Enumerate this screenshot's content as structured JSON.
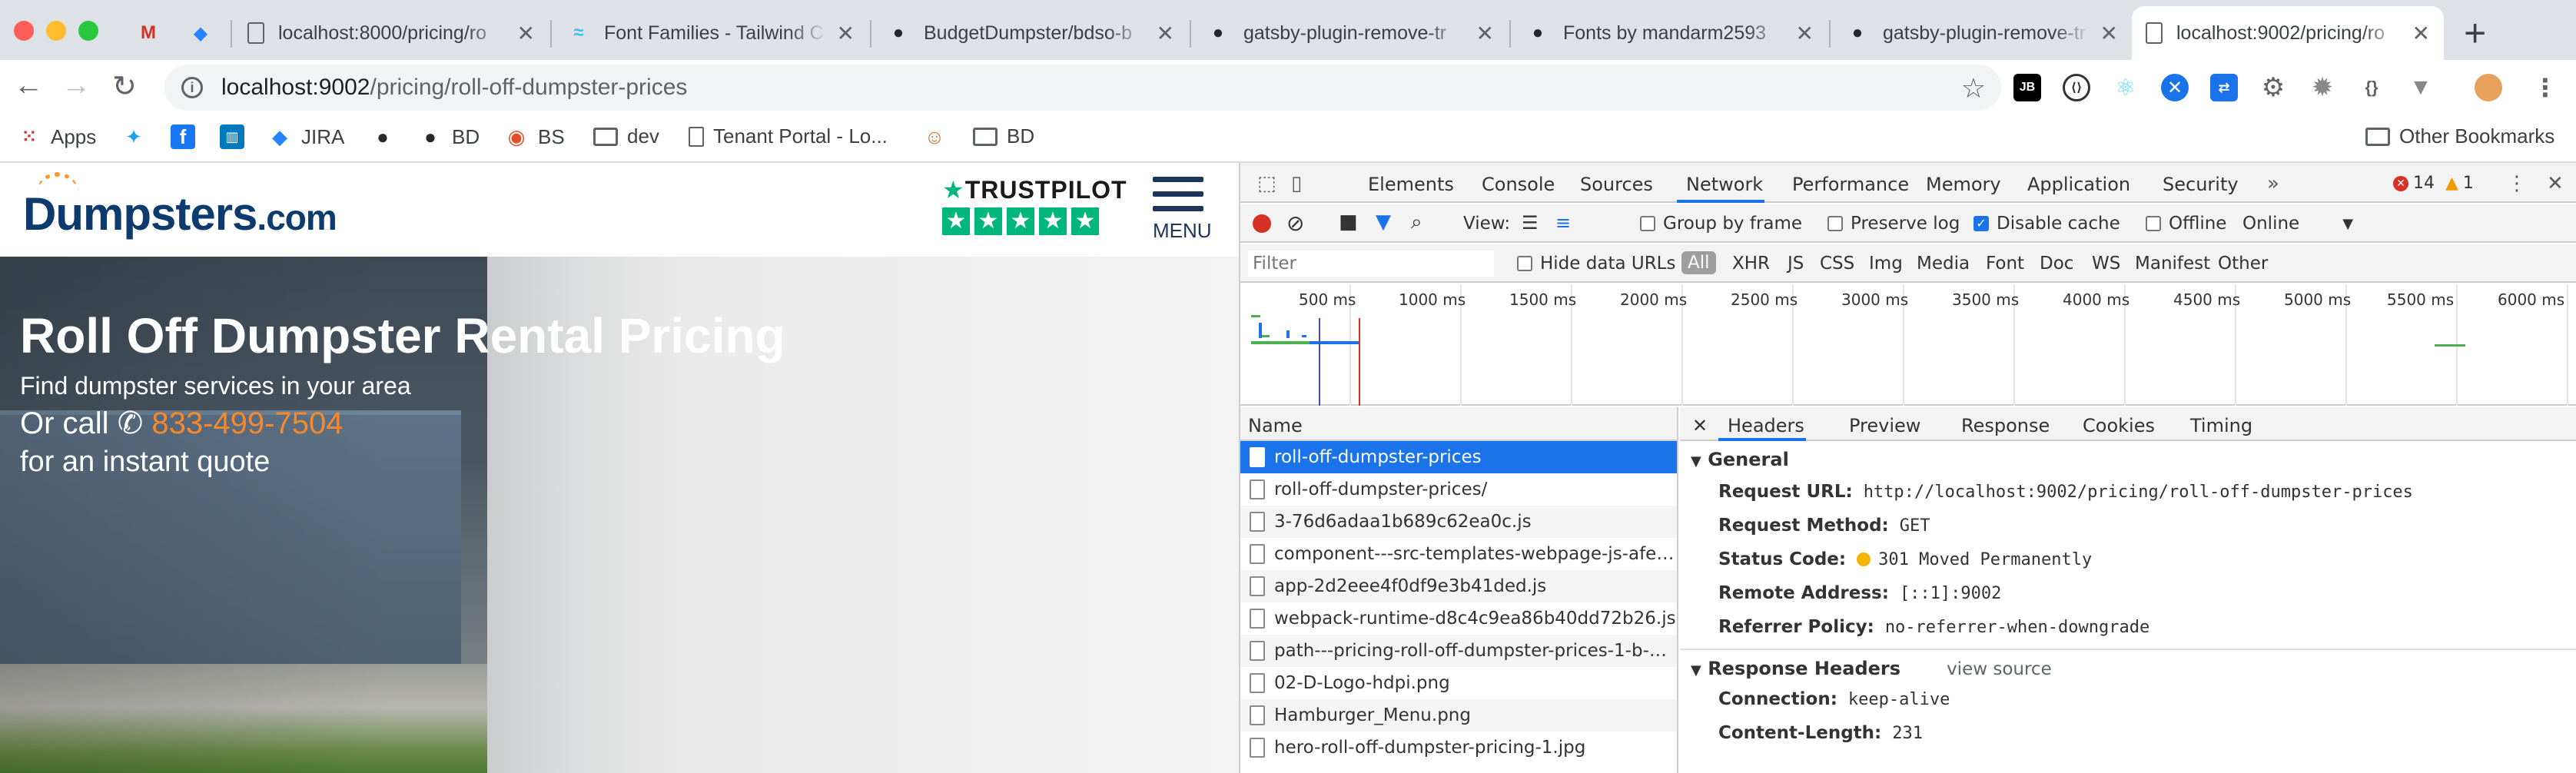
{
  "browser": {
    "tabs": [
      {
        "title": "",
        "icon": "gmail-icon"
      },
      {
        "title": "",
        "icon": "jira-icon"
      },
      {
        "title": "localhost:8000/pricing/ro",
        "icon": "page-icon"
      },
      {
        "title": "Font Families - Tailwind C",
        "icon": "tailwind-icon"
      },
      {
        "title": "BudgetDumpster/bdso-b",
        "icon": "github-icon"
      },
      {
        "title": "gatsby-plugin-remove-tr",
        "icon": "github-icon"
      },
      {
        "title": "Fonts by mandarm2593",
        "icon": "github-icon"
      },
      {
        "title": "gatsby-plugin-remove-tr",
        "icon": "github-icon"
      },
      {
        "title": "localhost:9002/pricing/ro",
        "icon": "page-icon",
        "active": true
      }
    ],
    "url_host": "localhost:9002",
    "url_path": "/pricing/roll-off-dumpster-prices",
    "bookmarks": [
      {
        "label": "Apps"
      },
      {
        "label": ""
      },
      {
        "label": ""
      },
      {
        "label": ""
      },
      {
        "label": "JIRA"
      },
      {
        "label": ""
      },
      {
        "label": "BD"
      },
      {
        "label": "BS"
      },
      {
        "label": "dev"
      },
      {
        "label": "Tenant Portal - Lo..."
      },
      {
        "label": ""
      },
      {
        "label": "BD"
      }
    ],
    "other_bookmarks": "Other Bookmarks"
  },
  "page": {
    "logo_text": "Dumpsters",
    "logo_suffix": ".com",
    "trustpilot_label": "TRUSTPILOT",
    "menu_label": "MENU",
    "hero_title": "Roll Off Dumpster Rental Pricing",
    "hero_subtitle": "Find dumpster services in your area",
    "hero_call_prefix": "Or call",
    "hero_phone": "833-499-7504",
    "hero_quote": "for an instant quote"
  },
  "devtools": {
    "panels": [
      "Elements",
      "Console",
      "Sources",
      "Network",
      "Performance",
      "Memory",
      "Application",
      "Security"
    ],
    "active_panel": "Network",
    "error_count": "14",
    "warning_count": "1",
    "toolbar": {
      "view_label": "View:",
      "group_by_frame": "Group by frame",
      "preserve_log": "Preserve log",
      "disable_cache": "Disable cache",
      "offline": "Offline",
      "throttle": "Online"
    },
    "filter": {
      "placeholder": "Filter",
      "hide_data_urls": "Hide data URLs",
      "types": [
        "All",
        "XHR",
        "JS",
        "CSS",
        "Img",
        "Media",
        "Font",
        "Doc",
        "WS",
        "Manifest",
        "Other"
      ]
    },
    "timeline_ticks": [
      "500 ms",
      "1000 ms",
      "1500 ms",
      "2000 ms",
      "2500 ms",
      "3000 ms",
      "3500 ms",
      "4000 ms",
      "4500 ms",
      "5000 ms",
      "5500 ms",
      "6000 ms"
    ],
    "name_header": "Name",
    "requests": [
      "roll-off-dumpster-prices",
      "roll-off-dumpster-prices/",
      "3-76d6adaa1b689c62ea0c.js",
      "component---src-templates-webpage-js-afe4...",
      "app-2d2eee4f0df9e3b41ded.js",
      "webpack-runtime-d8c4c9ea86b40dd72b26.js",
      "path---pricing-roll-off-dumpster-prices-1-b-1...",
      "02-D-Logo-hdpi.png",
      "Hamburger_Menu.png",
      "hero-roll-off-dumpster-pricing-1.jpg"
    ],
    "detail_tabs": [
      "Headers",
      "Preview",
      "Response",
      "Cookies",
      "Timing"
    ],
    "general_title": "General",
    "general": [
      {
        "key": "Request URL:",
        "value": "http://localhost:9002/pricing/roll-off-dumpster-prices"
      },
      {
        "key": "Request Method:",
        "value": "GET"
      },
      {
        "key": "Status Code:",
        "value": "301 Moved Permanently"
      },
      {
        "key": "Remote Address:",
        "value": "[::1]:9002"
      },
      {
        "key": "Referrer Policy:",
        "value": "no-referrer-when-downgrade"
      }
    ],
    "response_headers_title": "Response Headers",
    "view_source": "view source",
    "response_headers": [
      {
        "key": "Connection:",
        "value": "keep-alive"
      },
      {
        "key": "Content-Length:",
        "value": "231"
      }
    ]
  }
}
